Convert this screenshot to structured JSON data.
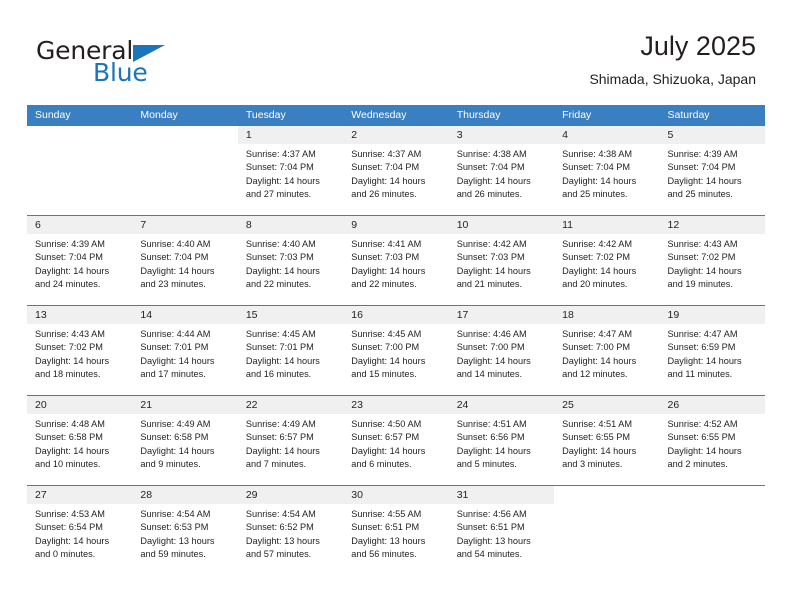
{
  "brand": {
    "word1": "General",
    "word2": "Blue",
    "accent_color": "#1a75bb"
  },
  "header": {
    "title": "July 2025",
    "location": "Shimada, Shizuoka, Japan"
  },
  "calendar": {
    "header_color": "#3a7fc1",
    "daynum_band_color": "#f0f0f0",
    "day_names": [
      "Sunday",
      "Monday",
      "Tuesday",
      "Wednesday",
      "Thursday",
      "Friday",
      "Saturday"
    ],
    "weeks": [
      [
        {
          "day": "",
          "blank": true
        },
        {
          "day": "",
          "blank": true
        },
        {
          "day": "1",
          "sunrise": "Sunrise: 4:37 AM",
          "sunset": "Sunset: 7:04 PM",
          "daylight1": "Daylight: 14 hours",
          "daylight2": "and 27 minutes."
        },
        {
          "day": "2",
          "sunrise": "Sunrise: 4:37 AM",
          "sunset": "Sunset: 7:04 PM",
          "daylight1": "Daylight: 14 hours",
          "daylight2": "and 26 minutes."
        },
        {
          "day": "3",
          "sunrise": "Sunrise: 4:38 AM",
          "sunset": "Sunset: 7:04 PM",
          "daylight1": "Daylight: 14 hours",
          "daylight2": "and 26 minutes."
        },
        {
          "day": "4",
          "sunrise": "Sunrise: 4:38 AM",
          "sunset": "Sunset: 7:04 PM",
          "daylight1": "Daylight: 14 hours",
          "daylight2": "and 25 minutes."
        },
        {
          "day": "5",
          "sunrise": "Sunrise: 4:39 AM",
          "sunset": "Sunset: 7:04 PM",
          "daylight1": "Daylight: 14 hours",
          "daylight2": "and 25 minutes."
        }
      ],
      [
        {
          "day": "6",
          "sunrise": "Sunrise: 4:39 AM",
          "sunset": "Sunset: 7:04 PM",
          "daylight1": "Daylight: 14 hours",
          "daylight2": "and 24 minutes."
        },
        {
          "day": "7",
          "sunrise": "Sunrise: 4:40 AM",
          "sunset": "Sunset: 7:04 PM",
          "daylight1": "Daylight: 14 hours",
          "daylight2": "and 23 minutes."
        },
        {
          "day": "8",
          "sunrise": "Sunrise: 4:40 AM",
          "sunset": "Sunset: 7:03 PM",
          "daylight1": "Daylight: 14 hours",
          "daylight2": "and 22 minutes."
        },
        {
          "day": "9",
          "sunrise": "Sunrise: 4:41 AM",
          "sunset": "Sunset: 7:03 PM",
          "daylight1": "Daylight: 14 hours",
          "daylight2": "and 22 minutes."
        },
        {
          "day": "10",
          "sunrise": "Sunrise: 4:42 AM",
          "sunset": "Sunset: 7:03 PM",
          "daylight1": "Daylight: 14 hours",
          "daylight2": "and 21 minutes."
        },
        {
          "day": "11",
          "sunrise": "Sunrise: 4:42 AM",
          "sunset": "Sunset: 7:02 PM",
          "daylight1": "Daylight: 14 hours",
          "daylight2": "and 20 minutes."
        },
        {
          "day": "12",
          "sunrise": "Sunrise: 4:43 AM",
          "sunset": "Sunset: 7:02 PM",
          "daylight1": "Daylight: 14 hours",
          "daylight2": "and 19 minutes."
        }
      ],
      [
        {
          "day": "13",
          "sunrise": "Sunrise: 4:43 AM",
          "sunset": "Sunset: 7:02 PM",
          "daylight1": "Daylight: 14 hours",
          "daylight2": "and 18 minutes."
        },
        {
          "day": "14",
          "sunrise": "Sunrise: 4:44 AM",
          "sunset": "Sunset: 7:01 PM",
          "daylight1": "Daylight: 14 hours",
          "daylight2": "and 17 minutes."
        },
        {
          "day": "15",
          "sunrise": "Sunrise: 4:45 AM",
          "sunset": "Sunset: 7:01 PM",
          "daylight1": "Daylight: 14 hours",
          "daylight2": "and 16 minutes."
        },
        {
          "day": "16",
          "sunrise": "Sunrise: 4:45 AM",
          "sunset": "Sunset: 7:00 PM",
          "daylight1": "Daylight: 14 hours",
          "daylight2": "and 15 minutes."
        },
        {
          "day": "17",
          "sunrise": "Sunrise: 4:46 AM",
          "sunset": "Sunset: 7:00 PM",
          "daylight1": "Daylight: 14 hours",
          "daylight2": "and 14 minutes."
        },
        {
          "day": "18",
          "sunrise": "Sunrise: 4:47 AM",
          "sunset": "Sunset: 7:00 PM",
          "daylight1": "Daylight: 14 hours",
          "daylight2": "and 12 minutes."
        },
        {
          "day": "19",
          "sunrise": "Sunrise: 4:47 AM",
          "sunset": "Sunset: 6:59 PM",
          "daylight1": "Daylight: 14 hours",
          "daylight2": "and 11 minutes."
        }
      ],
      [
        {
          "day": "20",
          "sunrise": "Sunrise: 4:48 AM",
          "sunset": "Sunset: 6:58 PM",
          "daylight1": "Daylight: 14 hours",
          "daylight2": "and 10 minutes."
        },
        {
          "day": "21",
          "sunrise": "Sunrise: 4:49 AM",
          "sunset": "Sunset: 6:58 PM",
          "daylight1": "Daylight: 14 hours",
          "daylight2": "and 9 minutes."
        },
        {
          "day": "22",
          "sunrise": "Sunrise: 4:49 AM",
          "sunset": "Sunset: 6:57 PM",
          "daylight1": "Daylight: 14 hours",
          "daylight2": "and 7 minutes."
        },
        {
          "day": "23",
          "sunrise": "Sunrise: 4:50 AM",
          "sunset": "Sunset: 6:57 PM",
          "daylight1": "Daylight: 14 hours",
          "daylight2": "and 6 minutes."
        },
        {
          "day": "24",
          "sunrise": "Sunrise: 4:51 AM",
          "sunset": "Sunset: 6:56 PM",
          "daylight1": "Daylight: 14 hours",
          "daylight2": "and 5 minutes."
        },
        {
          "day": "25",
          "sunrise": "Sunrise: 4:51 AM",
          "sunset": "Sunset: 6:55 PM",
          "daylight1": "Daylight: 14 hours",
          "daylight2": "and 3 minutes."
        },
        {
          "day": "26",
          "sunrise": "Sunrise: 4:52 AM",
          "sunset": "Sunset: 6:55 PM",
          "daylight1": "Daylight: 14 hours",
          "daylight2": "and 2 minutes."
        }
      ],
      [
        {
          "day": "27",
          "sunrise": "Sunrise: 4:53 AM",
          "sunset": "Sunset: 6:54 PM",
          "daylight1": "Daylight: 14 hours",
          "daylight2": "and 0 minutes."
        },
        {
          "day": "28",
          "sunrise": "Sunrise: 4:54 AM",
          "sunset": "Sunset: 6:53 PM",
          "daylight1": "Daylight: 13 hours",
          "daylight2": "and 59 minutes."
        },
        {
          "day": "29",
          "sunrise": "Sunrise: 4:54 AM",
          "sunset": "Sunset: 6:52 PM",
          "daylight1": "Daylight: 13 hours",
          "daylight2": "and 57 minutes."
        },
        {
          "day": "30",
          "sunrise": "Sunrise: 4:55 AM",
          "sunset": "Sunset: 6:51 PM",
          "daylight1": "Daylight: 13 hours",
          "daylight2": "and 56 minutes."
        },
        {
          "day": "31",
          "sunrise": "Sunrise: 4:56 AM",
          "sunset": "Sunset: 6:51 PM",
          "daylight1": "Daylight: 13 hours",
          "daylight2": "and 54 minutes."
        },
        {
          "day": "",
          "blank": true
        },
        {
          "day": "",
          "blank": true
        }
      ]
    ]
  }
}
